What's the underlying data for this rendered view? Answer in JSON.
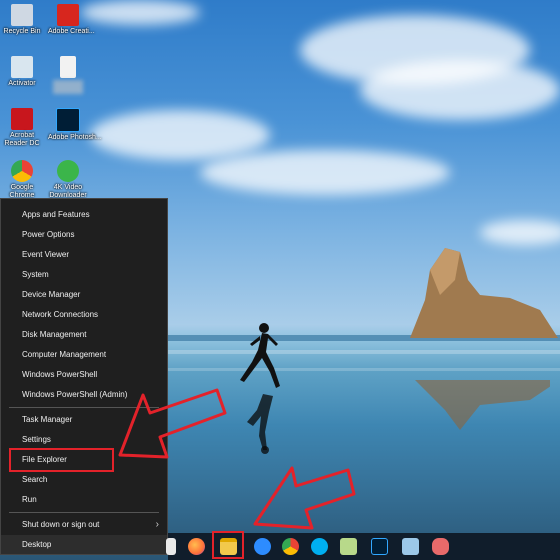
{
  "desktop": {
    "icons": [
      {
        "label": "Recycle Bin",
        "color": "#cfd8e3",
        "icon": "recycle-bin-icon"
      },
      {
        "label": "Adobe Creati...",
        "color": "#d7261e",
        "icon": "adobe-creative-cloud-icon"
      },
      {
        "label": "Activator",
        "color": "#d9e6ef",
        "icon": "activator-icon"
      },
      {
        "label": "",
        "color": "#f2f2f2",
        "icon": "document-icon"
      },
      {
        "label": "Acrobat Reader DC",
        "color": "#c8161d",
        "icon": "acrobat-reader-icon"
      },
      {
        "label": "Adobe Photosh...",
        "color": "#001e36",
        "icon": "photoshop-icon"
      },
      {
        "label": "Google Chrome",
        "color": "#4285f4",
        "icon": "chrome-icon"
      },
      {
        "label": "4K Video Downloader",
        "color": "#3bb54a",
        "icon": "4k-video-downloader-icon"
      }
    ]
  },
  "menu": {
    "items": [
      {
        "label": "Apps and Features"
      },
      {
        "label": "Power Options"
      },
      {
        "label": "Event Viewer"
      },
      {
        "label": "System"
      },
      {
        "label": "Device Manager"
      },
      {
        "label": "Network Connections"
      },
      {
        "label": "Disk Management"
      },
      {
        "label": "Computer Management"
      },
      {
        "label": "Windows PowerShell"
      },
      {
        "label": "Windows PowerShell (Admin)"
      }
    ],
    "items2": [
      {
        "label": "Task Manager"
      },
      {
        "label": "Settings"
      },
      {
        "label": "File Explorer"
      },
      {
        "label": "Search"
      },
      {
        "label": "Run"
      }
    ],
    "shutdown": "Shut down or sign out",
    "desktop": "Desktop"
  },
  "taskbar": {
    "apps": [
      {
        "icon": "mail-icon",
        "color": "#e9e9e9"
      },
      {
        "icon": "firefox-icon",
        "color": "#ff7139"
      },
      {
        "icon": "file-explorer-icon",
        "color": "#f2c94c"
      },
      {
        "icon": "chat-icon",
        "color": "#2d8cff"
      },
      {
        "icon": "chrome-icon",
        "color": "#4285f4"
      },
      {
        "icon": "skype-icon",
        "color": "#00aff0"
      },
      {
        "icon": "notepad-icon",
        "color": "#b8d98a"
      },
      {
        "icon": "photoshop-icon",
        "color": "#001e36"
      },
      {
        "icon": "remote-desktop-icon",
        "color": "#9cc8e8"
      },
      {
        "icon": "paint-icon",
        "color": "#e86a6a"
      }
    ]
  },
  "colors": {
    "highlight": "#e3222a",
    "menu_bg": "#1f1f1f",
    "taskbar_bg": "#101d2b"
  }
}
